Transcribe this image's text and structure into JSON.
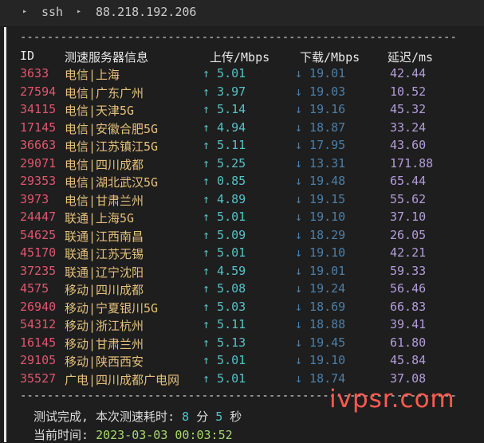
{
  "breadcrumb": {
    "part1": "ssh",
    "part2": "88.218.192.206"
  },
  "dashes": "--------------------------------------------------------------------------------",
  "table": {
    "headers": {
      "id": "ID",
      "isp": "测速服务器信息",
      "up": "上传/Mbps",
      "down": "下载/Mbps",
      "latency": "延迟/ms"
    },
    "rows": [
      {
        "id": "3633",
        "isp": "电信|上海",
        "up": "↑ 5.01",
        "down": "↓ 19.01",
        "latency": "42.44"
      },
      {
        "id": "27594",
        "isp": "电信|广东广州",
        "up": "↑ 3.97",
        "down": "↓ 19.03",
        "latency": "10.52"
      },
      {
        "id": "34115",
        "isp": "电信|天津5G",
        "up": "↑ 5.14",
        "down": "↓ 19.16",
        "latency": "45.32"
      },
      {
        "id": "17145",
        "isp": "电信|安徽合肥5G",
        "up": "↑ 4.94",
        "down": "↓ 18.87",
        "latency": "33.24"
      },
      {
        "id": "36663",
        "isp": "电信|江苏镇江5G",
        "up": "↑ 5.11",
        "down": "↓ 17.95",
        "latency": "43.60"
      },
      {
        "id": "29071",
        "isp": "电信|四川成都",
        "up": "↑ 5.25",
        "down": "↓ 13.31",
        "latency": "171.88"
      },
      {
        "id": "29353",
        "isp": "电信|湖北武汉5G",
        "up": "↑ 0.85",
        "down": "↓ 19.48",
        "latency": "65.44"
      },
      {
        "id": "3973",
        "isp": "电信|甘肃兰州",
        "up": "↑ 4.89",
        "down": "↓ 19.15",
        "latency": "55.62"
      },
      {
        "id": "24447",
        "isp": "联通|上海5G",
        "up": "↑ 5.01",
        "down": "↓ 19.10",
        "latency": "37.10"
      },
      {
        "id": "54625",
        "isp": "联通|江西南昌",
        "up": "↑ 5.09",
        "down": "↓ 18.29",
        "latency": "26.05"
      },
      {
        "id": "45170",
        "isp": "联通|江苏无锡",
        "up": "↑ 5.01",
        "down": "↓ 19.10",
        "latency": "42.21"
      },
      {
        "id": "37235",
        "isp": "联通|辽宁沈阳",
        "up": "↑ 4.59",
        "down": "↓ 19.01",
        "latency": "59.33"
      },
      {
        "id": "4575",
        "isp": "移动|四川成都",
        "up": "↑ 5.08",
        "down": "↓ 19.24",
        "latency": "56.46"
      },
      {
        "id": "26940",
        "isp": "移动|宁夏银川5G",
        "up": "↑ 5.03",
        "down": "↓ 18.69",
        "latency": "66.83"
      },
      {
        "id": "54312",
        "isp": "移动|浙江杭州",
        "up": "↑ 5.11",
        "down": "↓ 18.88",
        "latency": "39.41"
      },
      {
        "id": "16145",
        "isp": "移动|甘肃兰州",
        "up": "↑ 5.13",
        "down": "↓ 19.45",
        "latency": "61.80"
      },
      {
        "id": "29105",
        "isp": "移动|陕西西安",
        "up": "↑ 5.01",
        "down": "↓ 19.10",
        "latency": "45.84"
      },
      {
        "id": "35527",
        "isp": "广电|四川成都广电网",
        "up": "↑ 5.01",
        "down": "↓ 18.74",
        "latency": "37.08"
      }
    ]
  },
  "footer": {
    "done_label": "测试完成, 本次测速耗时:",
    "minutes": "8",
    "min_unit": "分",
    "seconds": "5",
    "sec_unit": "秒",
    "time_label": "当前时间:",
    "time_value": "2023-03-03 00:03:52"
  },
  "watermark": "ivpsr.com",
  "colors": {
    "id": "#e0566e",
    "isp": "#e5c07b",
    "upload": "#56c2c6",
    "download": "#4c7fa8",
    "latency": "#b39ddb",
    "watermark": "#ff5a4e"
  }
}
